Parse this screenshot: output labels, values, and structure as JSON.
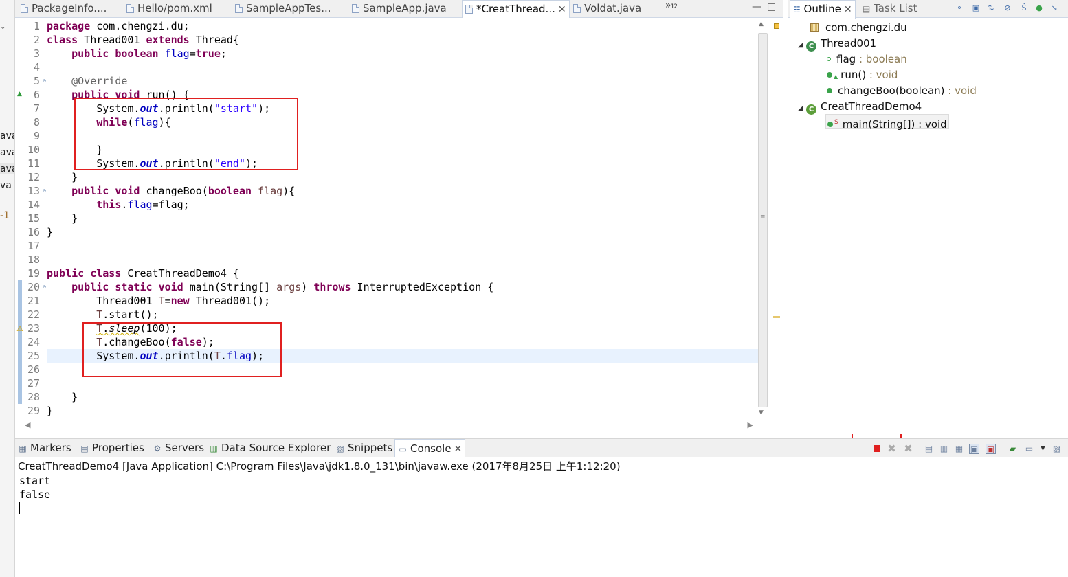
{
  "left_strip": {
    "items": [
      "ava",
      "ava",
      "ava",
      "va",
      "-1"
    ]
  },
  "editor": {
    "tabs": [
      {
        "label": "PackageInfo...."
      },
      {
        "label": "Hello/pom.xml"
      },
      {
        "label": "SampleAppTes..."
      },
      {
        "label": "SampleApp.java"
      },
      {
        "label": "*CreatThread...",
        "active": true
      },
      {
        "label": "Voldat.java"
      }
    ],
    "overflow_label": "»",
    "overflow_count": "12",
    "line_numbers": [
      "1",
      "2",
      "3",
      "4",
      "5",
      "6",
      "7",
      "8",
      "9",
      "10",
      "11",
      "12",
      "13",
      "14",
      "15",
      "16",
      "17",
      "18",
      "19",
      "20",
      "21",
      "22",
      "23",
      "24",
      "25",
      "26",
      "27",
      "28",
      "29"
    ],
    "code": {
      "l1_kw": "package",
      "l1_rest": " com.chengzi.du;",
      "l2_kw1": "class",
      "l2_mid": " Thread001 ",
      "l2_kw2": "extends",
      "l2_rest": " Thread{",
      "l3_indent": "    ",
      "l3_kw1": "public",
      "l3_kw2": "boolean",
      "l3_field": "flag",
      "l3_eq": "=",
      "l3_kw3": "true",
      "l3_semi": ";",
      "l5_ann": "    @Override",
      "l6_indent": "    ",
      "l6_kw1": "public",
      "l6_kw2": "void",
      "l6_rest": " run() {",
      "l7_a": "        System.",
      "l7_out": "out",
      "l7_b": ".println(",
      "l7_str": "\"start\"",
      "l7_c": ");",
      "l8_indent": "        ",
      "l8_kw": "while",
      "l8_a": "(",
      "l8_field": "flag",
      "l8_b": "){",
      "l10": "        }",
      "l11_a": "        System.",
      "l11_out": "out",
      "l11_b": ".println(",
      "l11_str": "\"end\"",
      "l11_c": ");",
      "l12": "    }",
      "l13_indent": "    ",
      "l13_kw1": "public",
      "l13_kw2": "void",
      "l13_a": " changeBoo(",
      "l13_kw3": "boolean",
      "l13_var": "flag",
      "l13_b": "){",
      "l14_indent": "        ",
      "l14_kw": "this",
      "l14_dot": ".",
      "l14_field": "flag",
      "l14_rest": "=flag;",
      "l15": "    }",
      "l16": "}",
      "l19_kw1": "public",
      "l19_kw2": "class",
      "l19_rest": " CreatThreadDemo4 {",
      "l20_indent": "    ",
      "l20_kw1": "public",
      "l20_kw2": "static",
      "l20_kw3": "void",
      "l20_a": " main(String[] ",
      "l20_var": "args",
      "l20_b": ") ",
      "l20_kw4": "throws",
      "l20_rest": " InterruptedException {",
      "l21_a": "        Thread001 ",
      "l21_var": "T",
      "l21_b": "=",
      "l21_kw": "new",
      "l21_rest": " Thread001();",
      "l22_indent": "        ",
      "l22_var": "T",
      "l22_rest": ".start();",
      "l23_indent": "        ",
      "l23_var": "T",
      "l23_dot": ".",
      "l23_m": "sleep",
      "l23_rest": "(100);",
      "l24_indent": "        ",
      "l24_var": "T",
      "l24_a": ".changeBoo(",
      "l24_kw": "false",
      "l24_b": ");",
      "l25_a": "        System.",
      "l25_out": "out",
      "l25_b": ".println(",
      "l25_var": "T",
      "l25_dot": ".",
      "l25_field": "flag",
      "l25_c": ");",
      "l28": "    }",
      "l29": "}"
    }
  },
  "outline": {
    "tabs": [
      {
        "label": "Outline",
        "active": true
      },
      {
        "label": "Task List"
      }
    ],
    "tree": [
      {
        "label": "com.chengzi.du",
        "type": "package"
      },
      {
        "label": "Thread001",
        "type": "class"
      },
      {
        "label": "flag",
        "suffix": " : boolean",
        "type": "field"
      },
      {
        "label": "run()",
        "suffix": " : void",
        "type": "method"
      },
      {
        "label": "changeBoo(boolean)",
        "suffix": " : void",
        "type": "method"
      },
      {
        "label": "CreatThreadDemo4",
        "type": "class"
      },
      {
        "label": "main(String[])",
        "suffix": " : void",
        "type": "static-method",
        "selected": true
      }
    ],
    "static_marker": "S"
  },
  "bottom": {
    "tabs": [
      {
        "label": "Markers"
      },
      {
        "label": "Properties"
      },
      {
        "label": "Servers"
      },
      {
        "label": "Data Source Explorer"
      },
      {
        "label": "Snippets"
      },
      {
        "label": "Console",
        "active": true
      }
    ]
  },
  "console": {
    "title": "CreatThreadDemo4 [Java Application] C:\\Program Files\\Java\\jdk1.8.0_131\\bin\\javaw.exe (2017年8月25日 上午1:12:20)",
    "output": [
      "start",
      "false"
    ]
  },
  "colors": {
    "keyword": "#7f0055",
    "string": "#2a00ff",
    "field": "#0000c0",
    "annotation": "#646464",
    "highlight_box": "#e02020",
    "terminate_red": "#e02020"
  }
}
